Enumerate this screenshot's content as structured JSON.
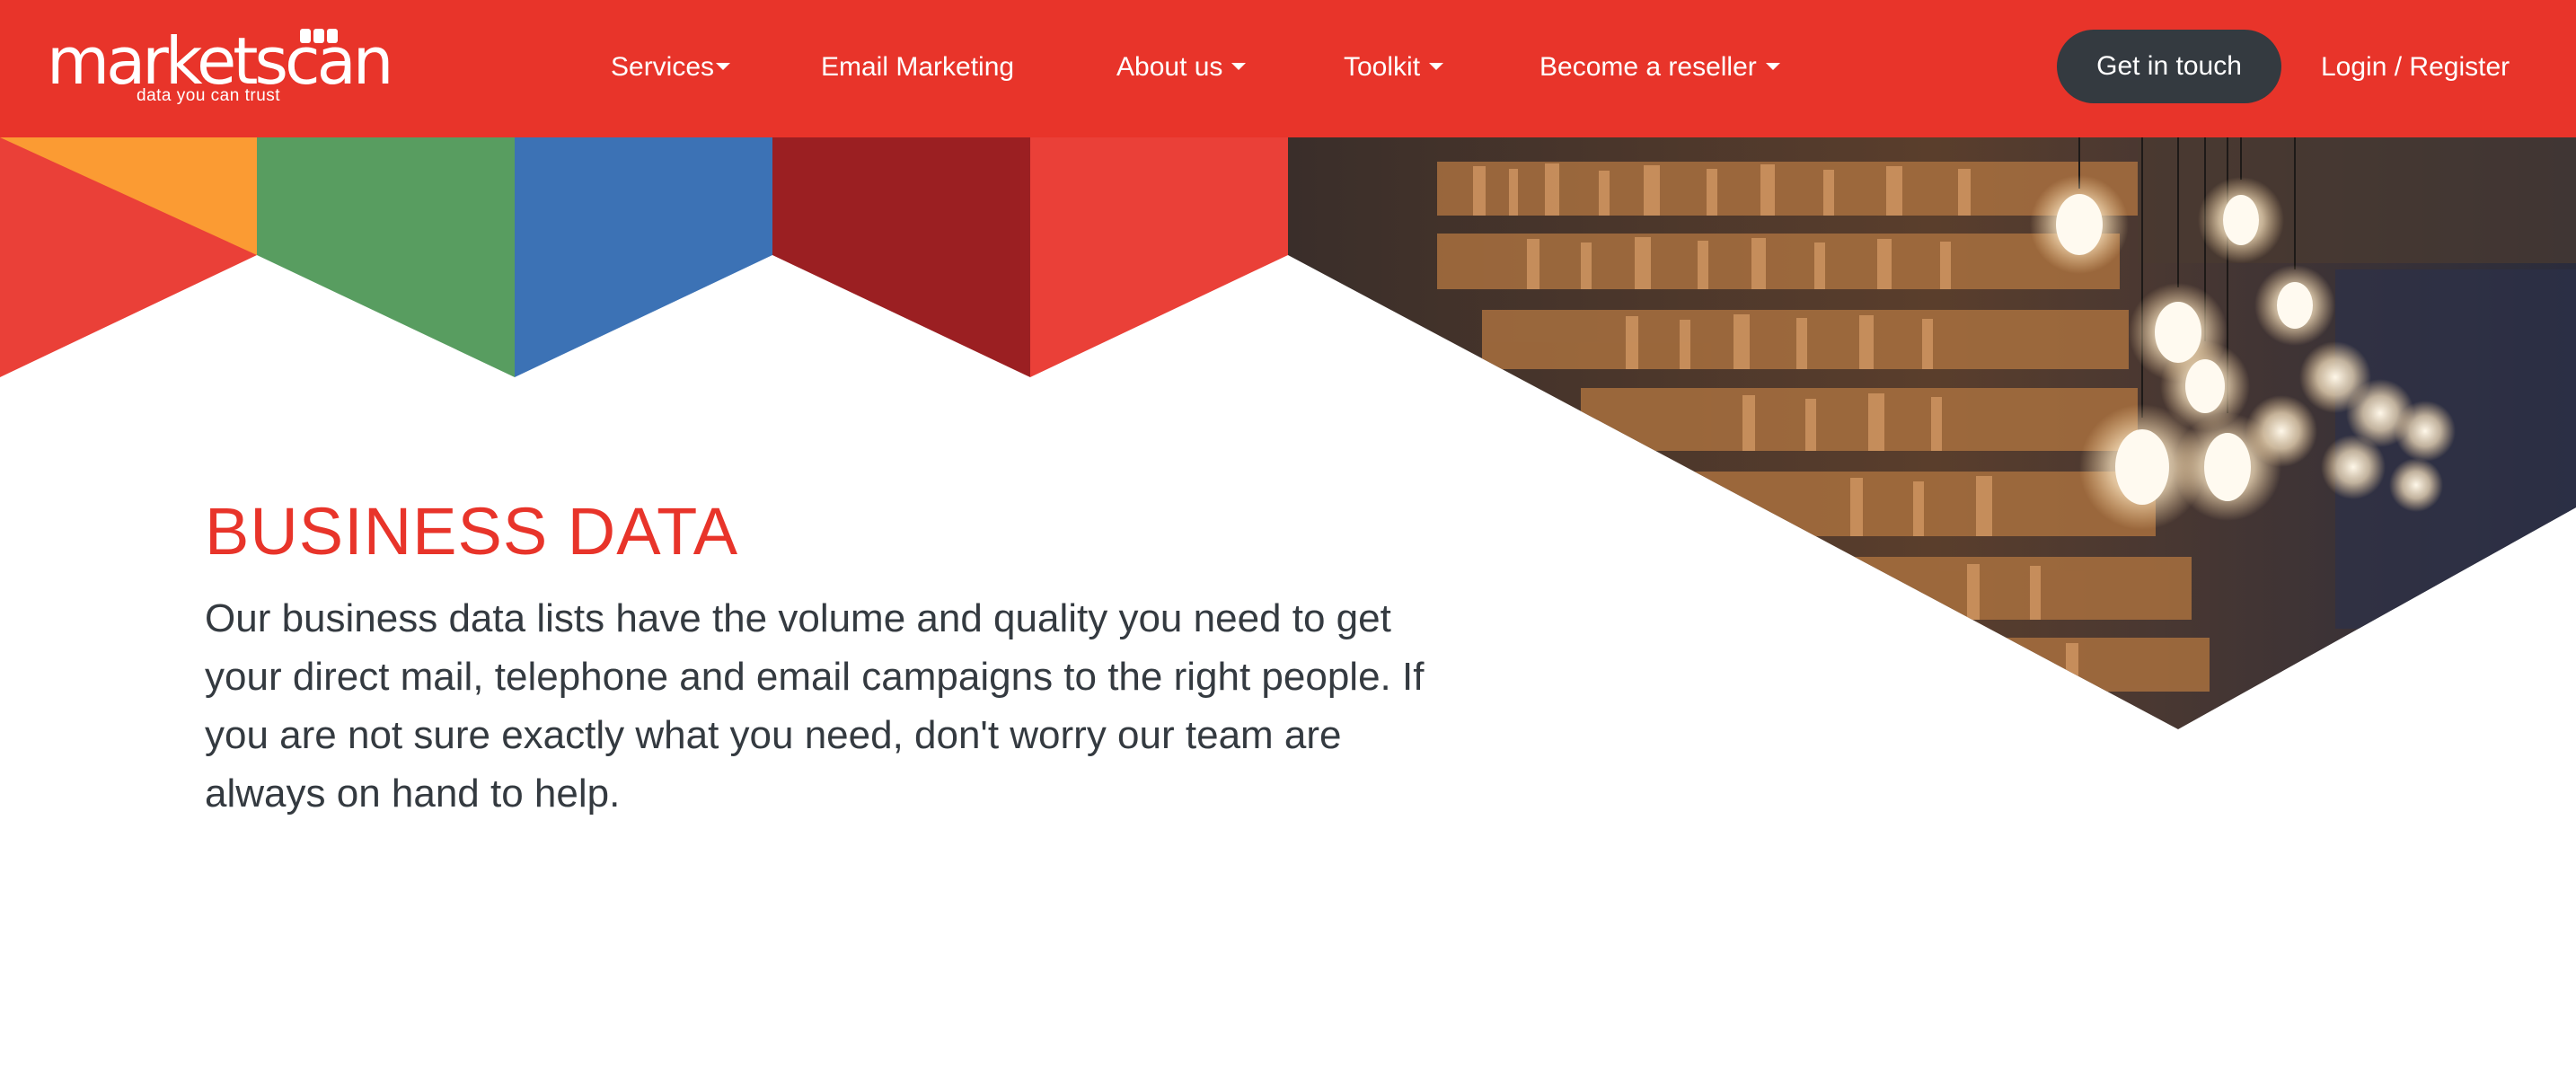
{
  "brand": {
    "name": "marketscan",
    "tagline": "data you can trust"
  },
  "nav": {
    "items": [
      {
        "label": "Services",
        "dropdown": true
      },
      {
        "label": "Email Marketing",
        "dropdown": false
      },
      {
        "label": "About us",
        "dropdown": true
      },
      {
        "label": "Toolkit",
        "dropdown": true
      },
      {
        "label": "Become a reseller",
        "dropdown": true
      }
    ],
    "cta_label": "Get in touch",
    "login_label": "Login / Register"
  },
  "hero": {
    "title": "BUSINESS DATA",
    "description": "Our business data lists have the volume and quality you need to get your direct mail, telephone and email campaigns to the right people. If you are not sure exactly what you need, don't worry our team are always on hand to help."
  },
  "colors": {
    "brand_red": "#e8342a",
    "dark_button": "#343a40",
    "orange": "#fb9b33",
    "green": "#589d60",
    "blue": "#3c72b5",
    "dark_red": "#9b1f22",
    "light_red": "#ea4038",
    "coral": "#f47a52"
  }
}
